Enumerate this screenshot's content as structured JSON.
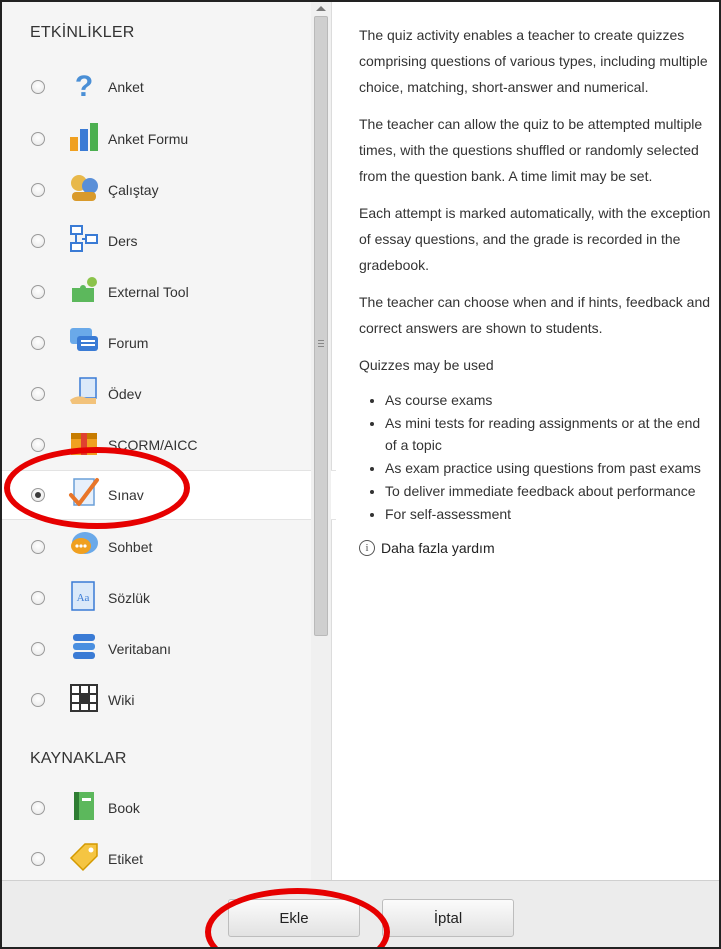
{
  "sections": {
    "activities_title": "ETKİNLİKLER",
    "resources_title": "KAYNAKLAR"
  },
  "activities": [
    {
      "label": "Anket",
      "icon": "question-icon",
      "selected": false
    },
    {
      "label": "Anket Formu",
      "icon": "bar-chart-icon",
      "selected": false
    },
    {
      "label": "Çalıştay",
      "icon": "people-icon",
      "selected": false
    },
    {
      "label": "Ders",
      "icon": "flowchart-icon",
      "selected": false
    },
    {
      "label": "External Tool",
      "icon": "puzzle-icon",
      "selected": false
    },
    {
      "label": "Forum",
      "icon": "chat-bubbles-icon",
      "selected": false
    },
    {
      "label": "Ödev",
      "icon": "hand-document-icon",
      "selected": false
    },
    {
      "label": "SCORM/AICC",
      "icon": "package-icon",
      "selected": false
    },
    {
      "label": "Sınav",
      "icon": "checkmark-document-icon",
      "selected": true
    },
    {
      "label": "Sohbet",
      "icon": "speech-bubble-icon",
      "selected": false
    },
    {
      "label": "Sözlük",
      "icon": "dictionary-icon",
      "selected": false
    },
    {
      "label": "Veritabanı",
      "icon": "database-icon",
      "selected": false
    },
    {
      "label": "Wiki",
      "icon": "wiki-grid-icon",
      "selected": false
    }
  ],
  "resources": [
    {
      "label": "Book",
      "icon": "book-icon",
      "selected": false
    },
    {
      "label": "Etiket",
      "icon": "tag-icon",
      "selected": false
    }
  ],
  "help": {
    "p1": "The quiz activity enables a teacher to create quizzes comprising questions of various types, including multiple choice, matching, short-answer and numerical.",
    "p2": "The teacher can allow the quiz to be attempted multiple times, with the questions shuffled or randomly selected from the question bank. A time limit may be set.",
    "p3": "Each attempt is marked automatically, with the exception of essay questions, and the grade is recorded in the gradebook.",
    "p4": "The teacher can choose when and if hints, feedback and correct answers are shown to students.",
    "p5": "Quizzes may be used",
    "uses": [
      "As course exams",
      "As mini tests for reading assignments or at the end of a topic",
      "As exam practice using questions from past exams",
      "To deliver immediate feedback about performance",
      "For self-assessment"
    ],
    "more_help": "Daha fazla yardım"
  },
  "footer": {
    "add_label": "Ekle",
    "cancel_label": "İptal"
  },
  "colors": {
    "annotation": "#e60000",
    "panel_bg": "#f5f5f5",
    "footer_bg": "#ececec"
  }
}
